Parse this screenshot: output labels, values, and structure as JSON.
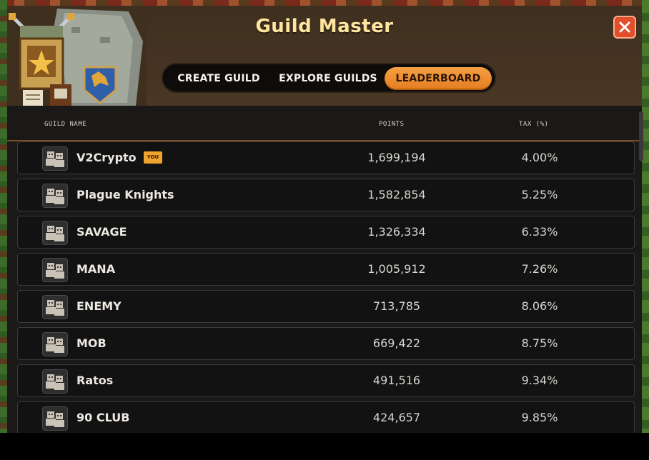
{
  "header": {
    "title": "Guild Master",
    "close_icon": "close-icon"
  },
  "tabs": [
    {
      "label": "CREATE GUILD",
      "active": false
    },
    {
      "label": "EXPLORE GUILDS",
      "active": false
    },
    {
      "label": "LEADERBOARD",
      "active": true
    }
  ],
  "columns": {
    "name": "GUILD NAME",
    "points": "POINTS",
    "tax": "TAX (%)"
  },
  "guilds": [
    {
      "name": "V2Crypto",
      "points": "1,699,194",
      "tax": "4.00%",
      "badge": "YOU"
    },
    {
      "name": "Plague Knights",
      "points": "1,582,854",
      "tax": "5.25%"
    },
    {
      "name": "SAVAGE",
      "points": "1,326,334",
      "tax": "6.33%"
    },
    {
      "name": "MANA",
      "points": "1,005,912",
      "tax": "7.26%"
    },
    {
      "name": "ENEMY",
      "points": "713,785",
      "tax": "8.06%"
    },
    {
      "name": "MOB",
      "points": "669,422",
      "tax": "8.75%"
    },
    {
      "name": "Ratos",
      "points": "491,516",
      "tax": "9.34%"
    },
    {
      "name": "90 CLUB",
      "points": "424,657",
      "tax": "9.85%"
    }
  ],
  "colors": {
    "accent": "#e47d1f",
    "close": "#e24d2c",
    "title": "#ffe6a0",
    "badge": "#f0a32e"
  }
}
